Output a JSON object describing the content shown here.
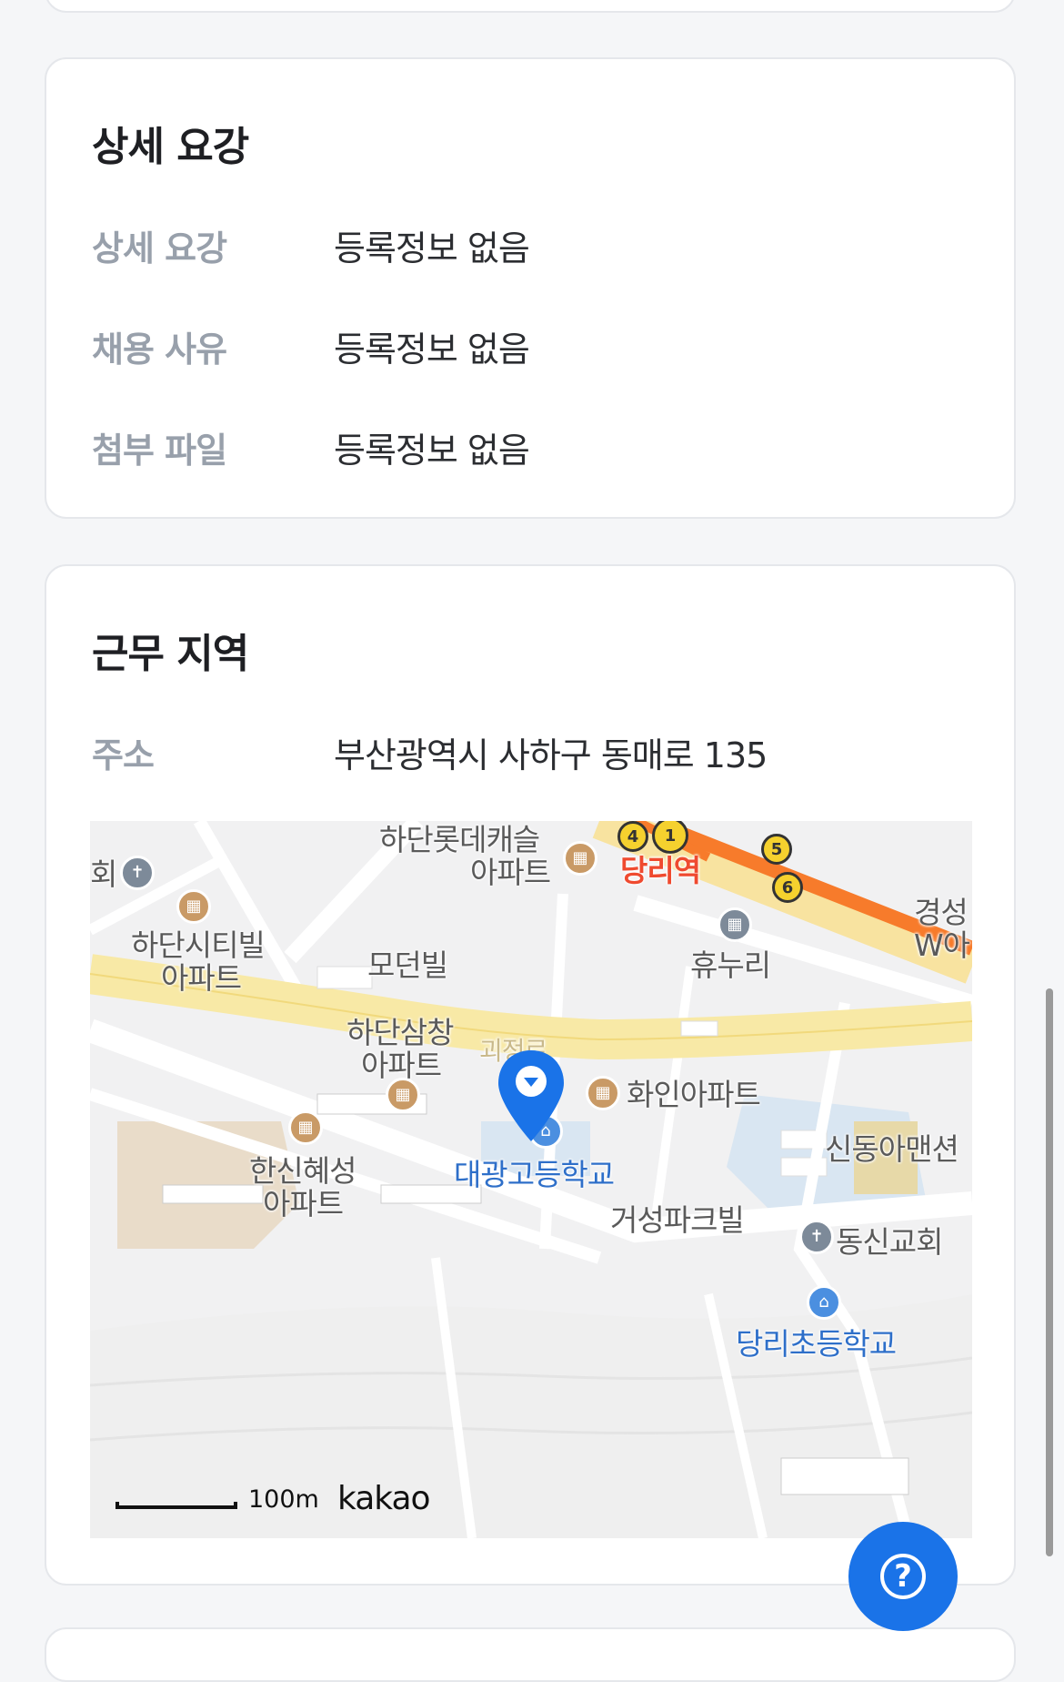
{
  "detail": {
    "title": "상세 요강",
    "rows": [
      {
        "label": "상세 요강",
        "value": "등록정보 없음"
      },
      {
        "label": "채용 사유",
        "value": "등록정보 없음"
      },
      {
        "label": "첨부 파일",
        "value": "등록정보 없음"
      }
    ]
  },
  "location": {
    "title": "근무 지역",
    "address_label": "주소",
    "address_value": "부산광역시 사하구 동매로 135"
  },
  "map": {
    "labels": {
      "hoe": "회",
      "lotte_castle": "하단롯데캐슬",
      "lotte_castle_2": "아파트",
      "dangni_station": "당리역",
      "city_vill": "하단시티빌",
      "city_vill_2": "아파트",
      "modern_vill": "모던빌",
      "hyunuri": "휴누리",
      "gyeongseong": "경성",
      "gyeongseong_2": "W아",
      "samchang": "하단삼창",
      "samchang_2": "아파트",
      "road_partial": "괴정로",
      "hwain_apt": "화인아파트",
      "hanshin": "한신혜성",
      "hanshin_2": "아파트",
      "daegwang_school": "대광고등학교",
      "shindonga": "신동아맨션",
      "geoseong_park": "거성파크빌",
      "dongshin_church": "동신교회",
      "dangni_elem": "당리초등학교"
    },
    "metro_lines": [
      "4",
      "1",
      "5",
      "6"
    ],
    "scale": "100m",
    "brand": "kakao",
    "colors": {
      "marker": "#1a73e8",
      "road": "#f8e9a6",
      "metro_line": "#f77b2b"
    }
  },
  "fab": {
    "label": "?"
  }
}
